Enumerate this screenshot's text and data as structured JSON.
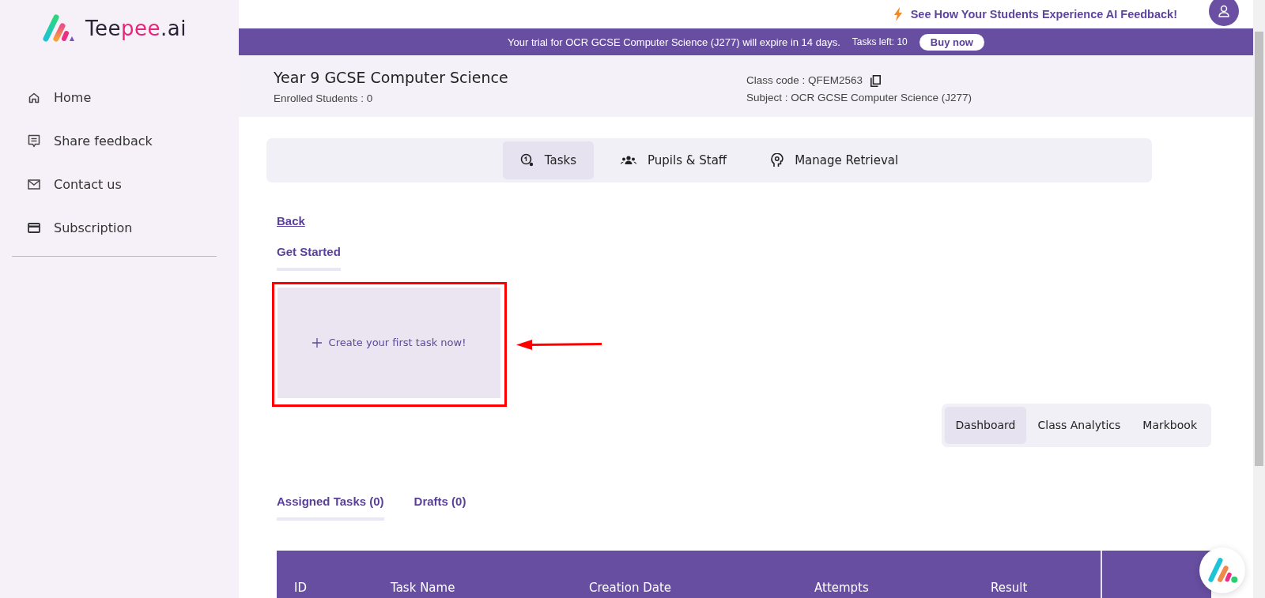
{
  "sidebar": {
    "logo": {
      "start": "Tee",
      "highlight": "pee",
      "end": ".ai"
    },
    "items": [
      {
        "label": "Home",
        "kind": "home"
      },
      {
        "label": "Share feedback",
        "kind": "feedback"
      },
      {
        "label": "Contact us",
        "kind": "mail"
      },
      {
        "label": "Subscription",
        "kind": "card"
      }
    ]
  },
  "topbar": {
    "promo": "See How Your Students Experience AI Feedback!"
  },
  "banner": {
    "message": "Your trial for OCR GCSE Computer Science (J277) will expire in 14 days.",
    "tasks_left": "Tasks left: 10",
    "button": "Buy now"
  },
  "class_header": {
    "title": "Year 9 GCSE Computer Science",
    "enrolled": "Enrolled Students : 0",
    "class_code": "Class code : QFEM2563",
    "subject": "Subject : OCR GCSE Computer Science (J277)"
  },
  "tabs": [
    {
      "label": "Tasks",
      "kind": "tasks",
      "selected": true
    },
    {
      "label": "Pupils & Staff",
      "kind": "people",
      "selected": false
    },
    {
      "label": "Manage Retrieval",
      "kind": "retrieval",
      "selected": false
    }
  ],
  "back_link": "Back",
  "get_started_tabs": [
    {
      "label": "Get Started",
      "selected": true
    }
  ],
  "create_card": {
    "label": "Create your first task now!"
  },
  "view_tabs": [
    {
      "label": "Dashboard",
      "selected": true
    },
    {
      "label": "Class Analytics",
      "selected": false
    },
    {
      "label": "Markbook",
      "selected": false
    }
  ],
  "task_tabs": [
    {
      "label": "Assigned Tasks (0)",
      "selected": true
    },
    {
      "label": "Drafts (0)",
      "selected": false
    }
  ],
  "table": {
    "columns": [
      "ID",
      "Task Name",
      "Creation Date",
      "Attempts",
      "Result"
    ]
  }
}
